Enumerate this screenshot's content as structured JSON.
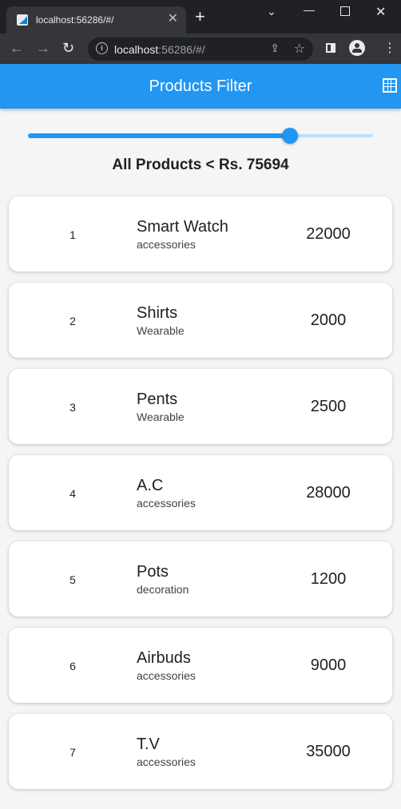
{
  "browser": {
    "tab_title": "localhost:56286/#/",
    "url_host": "localhost",
    "url_rest": ":56286/#/",
    "new_tab": "+",
    "tab_close": "✕"
  },
  "appbar": {
    "title": "Products Filter",
    "color": "#2196f3"
  },
  "filter": {
    "slider_fraction": 0.76,
    "label": "All Products < Rs. 75694"
  },
  "products": [
    {
      "index": "1",
      "name": "Smart Watch",
      "category": "accessories",
      "price": "22000"
    },
    {
      "index": "2",
      "name": "Shirts",
      "category": "Wearable",
      "price": "2000"
    },
    {
      "index": "3",
      "name": "Pents",
      "category": "Wearable",
      "price": "2500"
    },
    {
      "index": "4",
      "name": "A.C",
      "category": "accessories",
      "price": "28000"
    },
    {
      "index": "5",
      "name": "Pots",
      "category": "decoration",
      "price": "1200"
    },
    {
      "index": "6",
      "name": "Airbuds",
      "category": "accessories",
      "price": "9000"
    },
    {
      "index": "7",
      "name": "T.V",
      "category": "accessories",
      "price": "35000"
    }
  ]
}
